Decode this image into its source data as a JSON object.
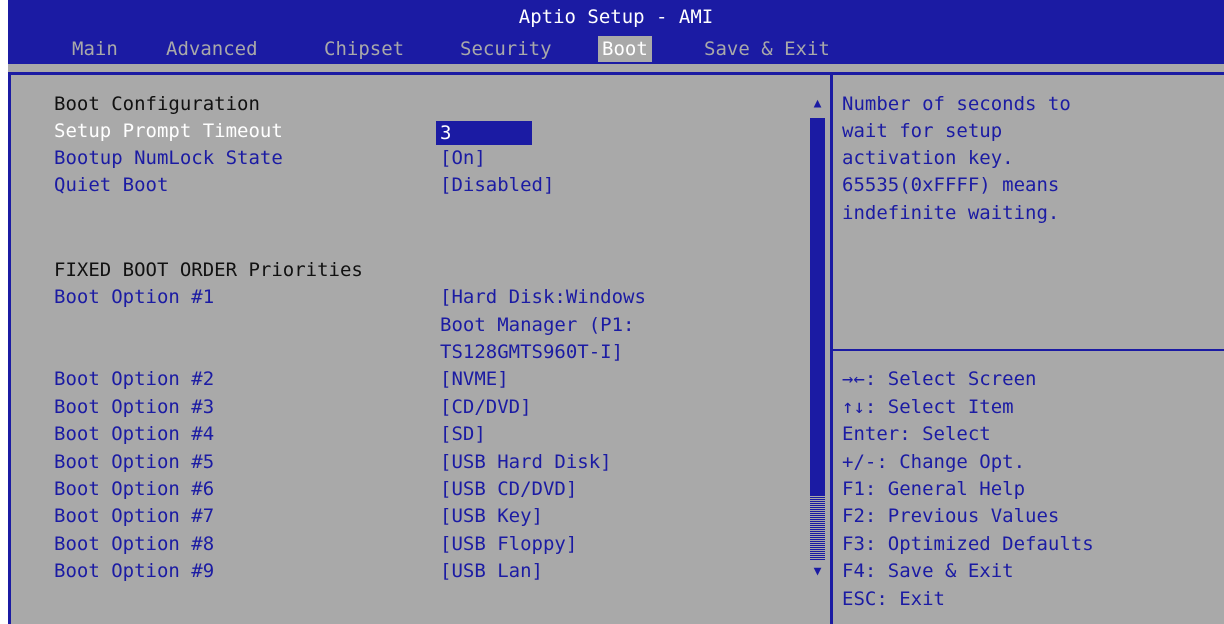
{
  "app_title": "Aptio Setup - AMI",
  "tabs": [
    {
      "label": "Main"
    },
    {
      "label": "Advanced"
    },
    {
      "label": "Chipset"
    },
    {
      "label": "Security"
    },
    {
      "label": "Boot"
    },
    {
      "label": "Save & Exit"
    }
  ],
  "active_tab": "Boot",
  "boot_config": {
    "heading": "Boot Configuration",
    "setup_prompt_timeout": {
      "label": "Setup Prompt Timeout",
      "value": "3"
    },
    "numlock": {
      "label": "Bootup NumLock State",
      "value": "[On]"
    },
    "quiet_boot": {
      "label": "Quiet Boot",
      "value": "[Disabled]"
    }
  },
  "fixed_boot": {
    "heading": "FIXED BOOT ORDER Priorities",
    "options": [
      {
        "label": "Boot Option #1",
        "value_lines": [
          "[Hard Disk:Windows",
          "Boot Manager (P1:",
          "TS128GMTS960T-I]"
        ]
      },
      {
        "label": "Boot Option #2",
        "value_lines": [
          "[NVME]"
        ]
      },
      {
        "label": "Boot Option #3",
        "value_lines": [
          "[CD/DVD]"
        ]
      },
      {
        "label": "Boot Option #4",
        "value_lines": [
          "[SD]"
        ]
      },
      {
        "label": "Boot Option #5",
        "value_lines": [
          "[USB Hard Disk]"
        ]
      },
      {
        "label": "Boot Option #6",
        "value_lines": [
          "[USB CD/DVD]"
        ]
      },
      {
        "label": "Boot Option #7",
        "value_lines": [
          "[USB Key]"
        ]
      },
      {
        "label": "Boot Option #8",
        "value_lines": [
          "[USB Floppy]"
        ]
      },
      {
        "label": "Boot Option #9",
        "value_lines": [
          "[USB Lan]"
        ]
      }
    ]
  },
  "help_text": [
    "Number of seconds to",
    "wait for setup",
    "activation key.",
    "65535(0xFFFF) means",
    "indefinite waiting."
  ],
  "key_legend": [
    "→←: Select Screen",
    "↑↓: Select Item",
    "Enter: Select",
    "+/-: Change Opt.",
    "F1: General Help",
    "F2: Previous Values",
    "F3: Optimized Defaults",
    "F4: Save & Exit",
    "ESC: Exit"
  ],
  "scroll_icons": {
    "up": "scroll-up-arrow-icon",
    "down": "scroll-down-arrow-icon"
  },
  "colors": {
    "background": "#a9a9a9",
    "accent_blue": "#1b1ba3",
    "highlight_text": "#ffffff"
  }
}
